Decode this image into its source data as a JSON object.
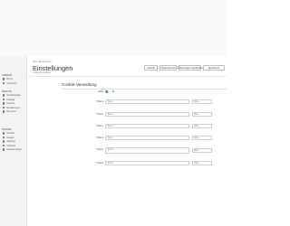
{
  "header": {
    "breadcrumb": "Start › Einstellungen",
    "title": "Einstellungen",
    "subtitle": "Cookie-Verwaltung"
  },
  "toolbar": {
    "buttons": [
      "Zurück",
      "Übernehmen",
      "Änderungen verwerfen",
      "Speichern"
    ]
  },
  "sidebar": {
    "groups": [
      {
        "title": "ANSICHT",
        "items": [
          "Home",
          "Übersicht"
        ]
      },
      {
        "title": "INHALTE",
        "items": [
          "Einstellungen",
          "Katalog",
          "Kunden",
          "Bestellungen",
          "Benutzer"
        ]
      },
      {
        "title": "SYSTEM",
        "items": [
          "Module",
          "Design",
          "Zahlung",
          "Versand",
          "Erweiterungen"
        ]
      }
    ]
  },
  "section": {
    "title": "Cookie-Verwaltung",
    "active_label": "Aktiv",
    "active_value": "Ja"
  },
  "fields": [
    {
      "label": "Text 1",
      "value": "Text 1",
      "lang": "DE"
    },
    {
      "label": "Text 2",
      "value": "Text 2",
      "lang": "DE"
    },
    {
      "label": "Text 3",
      "value": "Text 3",
      "lang": "DE"
    },
    {
      "label": "Text 4",
      "value": "Text 4",
      "lang": "DE"
    },
    {
      "label": "Text 5",
      "value": "Text 5",
      "lang": "DE"
    },
    {
      "label": "Text 6",
      "value": "Text 6",
      "lang": "DE"
    }
  ],
  "colors": {
    "toggle_on": "#4caf50",
    "required": "#dd3333",
    "sidebar_bg": "#f4f4f4"
  }
}
